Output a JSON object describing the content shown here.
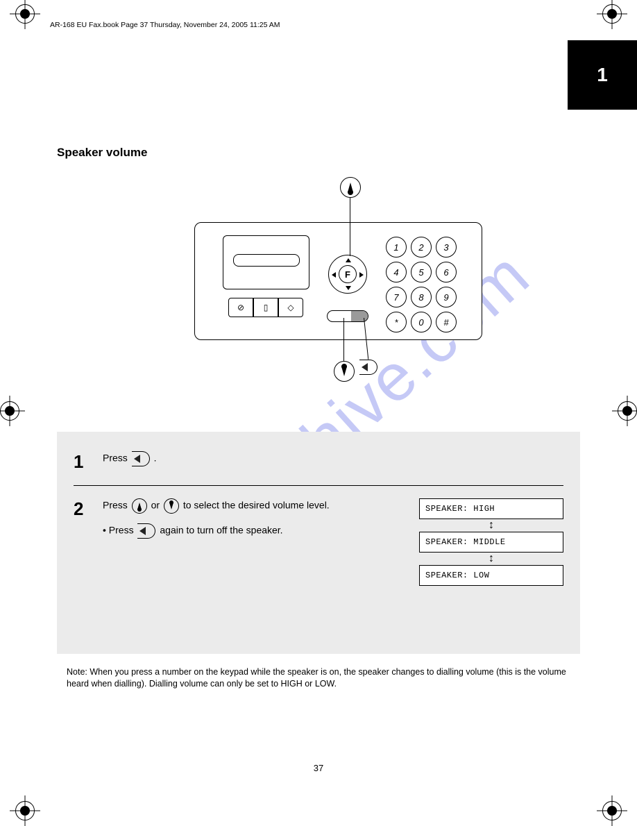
{
  "topline": "AR-168 EU Fax.book  Page 37  Thursday, November 24, 2005  11:25 AM",
  "page_header_number": "1",
  "section_heading": "Speaker volume",
  "keypad": [
    "1",
    "2",
    "3",
    "4",
    "5",
    "6",
    "7",
    "8",
    "9",
    "*",
    "0",
    "#"
  ],
  "dpad_center": "F",
  "steps": [
    {
      "num": "1",
      "text_before_icon": "Press",
      "text_after_icon": "."
    },
    {
      "num": "2",
      "text_a": "Press",
      "text_b": "or",
      "text_c": "to select the desired volume level.",
      "note_before_icon": "Press",
      "note_after_icon": "again to turn off the speaker.",
      "lcd": [
        "SPEAKER: HIGH",
        "SPEAKER: MIDDLE",
        "SPEAKER: LOW"
      ]
    }
  ],
  "footnote": "Note: When you press a number on the keypad while the speaker is on, the speaker changes to dialling volume (this is the volume heard when dialling). Dialling volume can only be set to HIGH or LOW.",
  "page_footer": "37",
  "watermark": "manualshive.com"
}
